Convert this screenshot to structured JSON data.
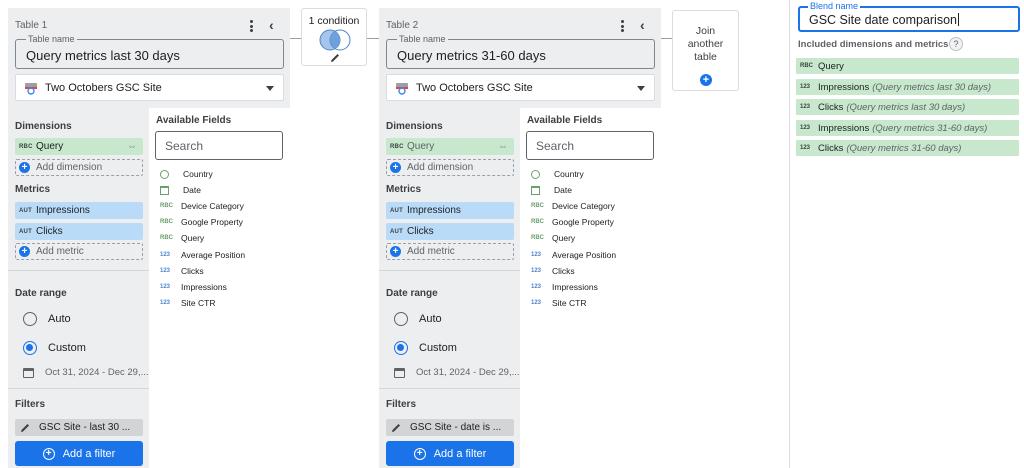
{
  "colors": {
    "primary": "#1a73e8",
    "dimension_chip": "#c7e8cc",
    "metric_chip": "#b9dbf7",
    "panel_bg": "#eceef0"
  },
  "join_condition": {
    "label": "1 condition",
    "icon": "venn-diagram-icon",
    "edit_icon": "pencil-icon"
  },
  "join_another": {
    "label_line1": "Join",
    "label_line2": "another",
    "label_line3": "table",
    "icon": "plus-circle-icon"
  },
  "tables": [
    {
      "title": "Table 1",
      "name_label": "Table name",
      "name_value": "Query metrics last 30 days",
      "data_source": "Two Octobers GSC Site",
      "dimensions_label": "Dimensions",
      "dimensions": [
        {
          "type": "RBC",
          "label": "Query",
          "link_icon": "⇔"
        }
      ],
      "add_dimension": "Add dimension",
      "metrics_label": "Metrics",
      "metrics": [
        {
          "type": "AUT",
          "label": "Impressions"
        },
        {
          "type": "AUT",
          "label": "Clicks"
        }
      ],
      "add_metric": "Add metric",
      "date_range_label": "Date range",
      "date_options": [
        {
          "label": "Auto",
          "selected": false
        },
        {
          "label": "Custom",
          "selected": true
        }
      ],
      "date_value": "Oct 31, 2024 - Dec 29,...",
      "filters_label": "Filters",
      "filter_value": "GSC Site - last 30 ...",
      "add_filter": "Add a filter",
      "available_fields_label": "Available Fields",
      "search_placeholder": "Search",
      "fields": [
        {
          "type": "geo",
          "label": "Country"
        },
        {
          "type": "date",
          "label": "Date"
        },
        {
          "type": "RBC",
          "label": "Device Category"
        },
        {
          "type": "RBC",
          "label": "Google Property"
        },
        {
          "type": "RBC",
          "label": "Query"
        },
        {
          "type": "123",
          "label": "Average Position"
        },
        {
          "type": "123",
          "label": "Clicks"
        },
        {
          "type": "123",
          "label": "Impressions"
        },
        {
          "type": "123",
          "label": "Site CTR"
        }
      ]
    },
    {
      "title": "Table 2",
      "name_label": "Table name",
      "name_value": "Query metrics 31-60 days",
      "data_source": "Two Octobers GSC Site",
      "dimensions_label": "Dimensions",
      "dimensions": [
        {
          "type": "RBC",
          "label": "Query",
          "link_icon": "⇔"
        }
      ],
      "add_dimension": "Add dimension",
      "metrics_label": "Metrics",
      "metrics": [
        {
          "type": "AUT",
          "label": "Impressions"
        },
        {
          "type": "AUT",
          "label": "Clicks"
        }
      ],
      "add_metric": "Add metric",
      "date_range_label": "Date range",
      "date_options": [
        {
          "label": "Auto",
          "selected": false
        },
        {
          "label": "Custom",
          "selected": true
        }
      ],
      "date_value": "Oct 31, 2024 - Dec 29,...",
      "filters_label": "Filters",
      "filter_value": "GSC Site - date is ...",
      "add_filter": "Add a filter",
      "available_fields_label": "Available Fields",
      "search_placeholder": "Search",
      "fields": [
        {
          "type": "geo",
          "label": "Country"
        },
        {
          "type": "date",
          "label": "Date"
        },
        {
          "type": "RBC",
          "label": "Device Category"
        },
        {
          "type": "RBC",
          "label": "Google Property"
        },
        {
          "type": "RBC",
          "label": "Query"
        },
        {
          "type": "123",
          "label": "Average Position"
        },
        {
          "type": "123",
          "label": "Clicks"
        },
        {
          "type": "123",
          "label": "Impressions"
        },
        {
          "type": "123",
          "label": "Site CTR"
        }
      ]
    }
  ],
  "blend": {
    "name_label": "Blend name",
    "name_value": "GSC Site date comparison",
    "included_label": "Included dimensions and metrics",
    "help_icon": "?",
    "items": [
      {
        "type": "RBC",
        "label": "Query",
        "source": ""
      },
      {
        "type": "123",
        "label": "Impressions",
        "source": "(Query metrics last 30 days)"
      },
      {
        "type": "123",
        "label": "Clicks",
        "source": "(Query metrics last 30 days)"
      },
      {
        "type": "123",
        "label": "Impressions",
        "source": "(Query metrics 31-60 days)"
      },
      {
        "type": "123",
        "label": "Clicks",
        "source": "(Query metrics 31-60 days)"
      }
    ]
  }
}
